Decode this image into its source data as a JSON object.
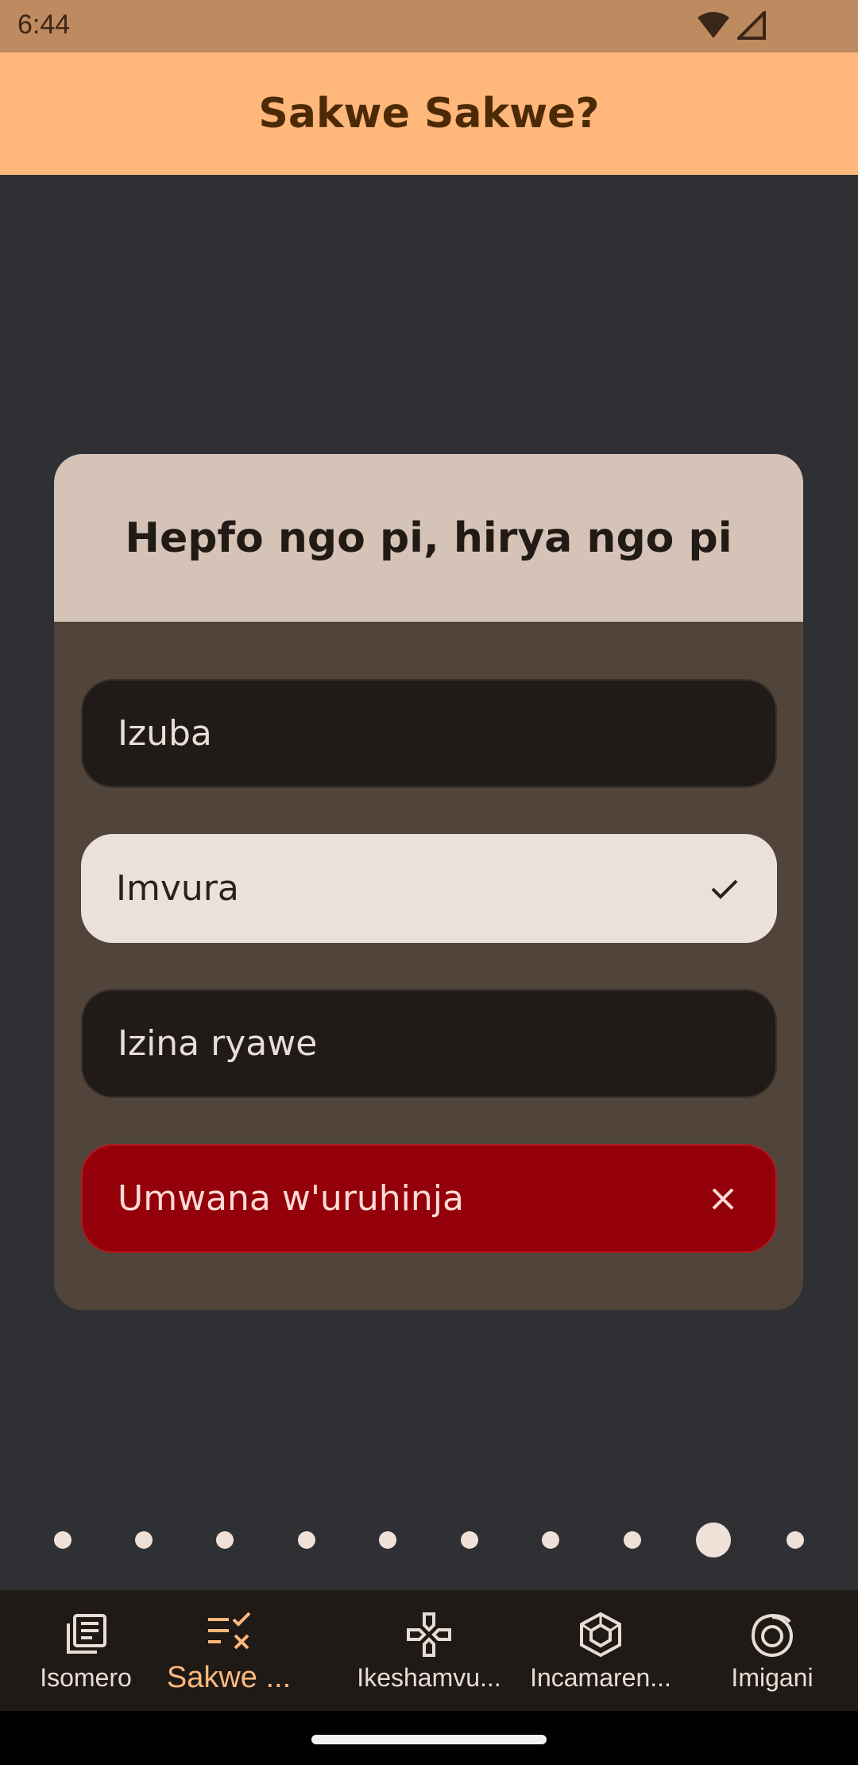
{
  "status_bar": {
    "time": "6:44"
  },
  "app_bar": {
    "title": "Sakwe Sakwe?"
  },
  "quiz": {
    "question": "Hepfo ngo pi, hirya ngo pi",
    "options": [
      {
        "label": "Izuba",
        "state": "neutral"
      },
      {
        "label": "Imvura",
        "state": "correct"
      },
      {
        "label": "Izina ryawe",
        "state": "neutral"
      },
      {
        "label": "Umwana w'uruhinja",
        "state": "wrong"
      }
    ]
  },
  "pager": {
    "total_pages": 10,
    "current_page": 9
  },
  "bottom_nav": {
    "items": [
      {
        "label": "Isomero",
        "icon": "library-icon",
        "selected": false
      },
      {
        "label": "Sakwe ...",
        "icon": "quiz-checklist-icon",
        "selected": true
      },
      {
        "label": "Ikeshamvu...",
        "icon": "gamepad-icon",
        "selected": false
      },
      {
        "label": "Incamaren...",
        "icon": "cube-icon",
        "selected": false
      },
      {
        "label": "Imigani",
        "icon": "spiral-icon",
        "selected": false
      }
    ]
  },
  "colors": {
    "app_bar": "#ffb77c",
    "background": "#2f3033",
    "card": "#51443b",
    "correct": "#ebe0dc",
    "wrong": "#93000a",
    "accent": "#ffb77c"
  }
}
